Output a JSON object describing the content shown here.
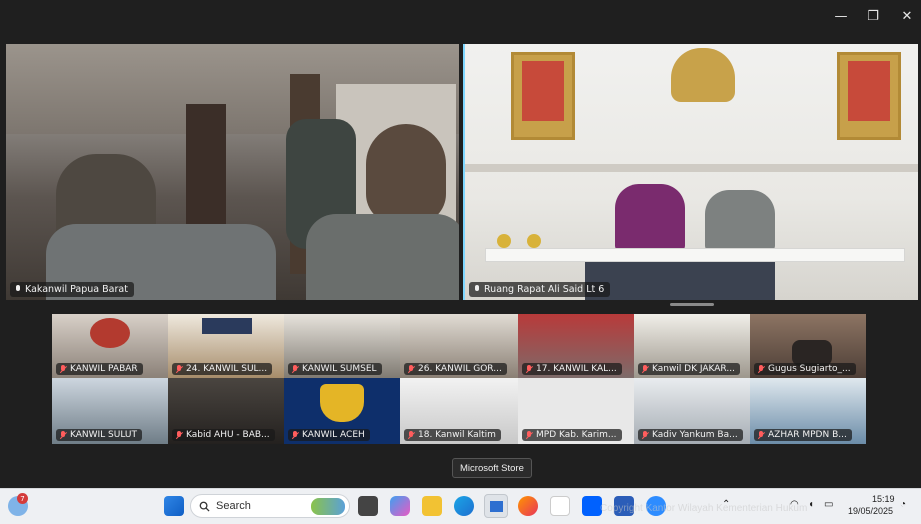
{
  "window": {
    "minimize": "—",
    "restore": "❐",
    "close": "✕"
  },
  "main_tiles": [
    {
      "label": "Kakanwil Papua Barat"
    },
    {
      "label": "Ruang Rapat Ali Said Lt 6"
    }
  ],
  "gallery": [
    {
      "label": "KANWIL PABAR"
    },
    {
      "label": "24. KANWIL SUL..."
    },
    {
      "label": "KANWIL SUMSEL"
    },
    {
      "label": "26. KANWIL GOR..."
    },
    {
      "label": "17. KANWIL KAL..."
    },
    {
      "label": "Kanwil DK JAKAR..."
    },
    {
      "label": "Gugus Sugiarto_..."
    },
    {
      "label": "KANWIL SULUT"
    },
    {
      "label": "Kabid AHU - BAB..."
    },
    {
      "label": "KANWIL ACEH"
    },
    {
      "label": "18. Kanwil Kaltim"
    },
    {
      "label": "MPD Kab. Karim..."
    },
    {
      "label": "Kadiv Yankum Ba..."
    },
    {
      "label": "AZHAR MPDN B..."
    }
  ],
  "tooltip": "Microsoft Store",
  "taskbar": {
    "weather_badge": "7",
    "search_placeholder": "Search",
    "time": "15:19",
    "date": "19/05/2025"
  },
  "watermark": "Copyright Kantor Wilayah Kementerian Hukum"
}
